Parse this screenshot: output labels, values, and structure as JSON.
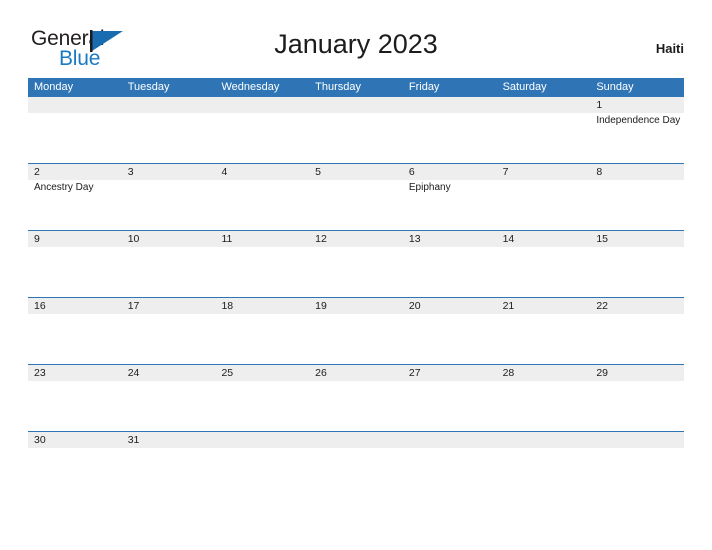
{
  "brand": {
    "word_one": "General",
    "word_two": "Blue",
    "flag_icon": "blue-triangle-flag-icon",
    "accent_color": "#1a7bc4"
  },
  "header": {
    "title": "January 2023",
    "country": "Haiti"
  },
  "calendar": {
    "header_color": "#2f75b5",
    "band_color": "#eeeeee",
    "weekdays": [
      "Monday",
      "Tuesday",
      "Wednesday",
      "Thursday",
      "Friday",
      "Saturday",
      "Sunday"
    ],
    "weeks": [
      {
        "compact": false,
        "days": [
          {
            "num": "",
            "event": ""
          },
          {
            "num": "",
            "event": ""
          },
          {
            "num": "",
            "event": ""
          },
          {
            "num": "",
            "event": ""
          },
          {
            "num": "",
            "event": ""
          },
          {
            "num": "",
            "event": ""
          },
          {
            "num": "1",
            "event": "Independence Day"
          }
        ]
      },
      {
        "compact": false,
        "days": [
          {
            "num": "2",
            "event": "Ancestry Day"
          },
          {
            "num": "3",
            "event": ""
          },
          {
            "num": "4",
            "event": ""
          },
          {
            "num": "5",
            "event": ""
          },
          {
            "num": "6",
            "event": "Epiphany"
          },
          {
            "num": "7",
            "event": ""
          },
          {
            "num": "8",
            "event": ""
          }
        ]
      },
      {
        "compact": false,
        "days": [
          {
            "num": "9",
            "event": ""
          },
          {
            "num": "10",
            "event": ""
          },
          {
            "num": "11",
            "event": ""
          },
          {
            "num": "12",
            "event": ""
          },
          {
            "num": "13",
            "event": ""
          },
          {
            "num": "14",
            "event": ""
          },
          {
            "num": "15",
            "event": ""
          }
        ]
      },
      {
        "compact": false,
        "days": [
          {
            "num": "16",
            "event": ""
          },
          {
            "num": "17",
            "event": ""
          },
          {
            "num": "18",
            "event": ""
          },
          {
            "num": "19",
            "event": ""
          },
          {
            "num": "20",
            "event": ""
          },
          {
            "num": "21",
            "event": ""
          },
          {
            "num": "22",
            "event": ""
          }
        ]
      },
      {
        "compact": false,
        "days": [
          {
            "num": "23",
            "event": ""
          },
          {
            "num": "24",
            "event": ""
          },
          {
            "num": "25",
            "event": ""
          },
          {
            "num": "26",
            "event": ""
          },
          {
            "num": "27",
            "event": ""
          },
          {
            "num": "28",
            "event": ""
          },
          {
            "num": "29",
            "event": ""
          }
        ]
      },
      {
        "compact": true,
        "days": [
          {
            "num": "30",
            "event": ""
          },
          {
            "num": "31",
            "event": ""
          },
          {
            "num": "",
            "event": ""
          },
          {
            "num": "",
            "event": ""
          },
          {
            "num": "",
            "event": ""
          },
          {
            "num": "",
            "event": ""
          },
          {
            "num": "",
            "event": ""
          }
        ]
      }
    ]
  }
}
